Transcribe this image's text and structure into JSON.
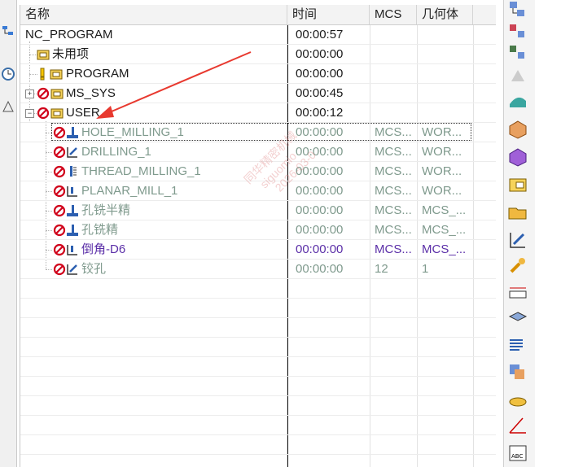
{
  "columns": {
    "name": "名称",
    "time": "时间",
    "mcs": "MCS",
    "geometry": "几何体"
  },
  "rows": [
    {
      "name": "NC_PROGRAM",
      "time": "00:00:57",
      "mcs": "",
      "geometry": ""
    },
    {
      "name": "未用项",
      "time": "00:00:00",
      "mcs": "",
      "geometry": ""
    },
    {
      "name": "PROGRAM",
      "time": "00:00:00",
      "mcs": "",
      "geometry": ""
    },
    {
      "name": "MS_SYS",
      "time": "00:00:45",
      "mcs": "",
      "geometry": ""
    },
    {
      "name": "USER",
      "time": "00:00:12",
      "mcs": "",
      "geometry": ""
    },
    {
      "name": "HOLE_MILLING_1",
      "time": "00:00:00",
      "mcs": "MCS...",
      "geometry": "WOR..."
    },
    {
      "name": "DRILLING_1",
      "time": "00:00:00",
      "mcs": "MCS...",
      "geometry": "WOR..."
    },
    {
      "name": "THREAD_MILLING_1",
      "time": "00:00:00",
      "mcs": "MCS...",
      "geometry": "WOR..."
    },
    {
      "name": "PLANAR_MILL_1",
      "time": "00:00:00",
      "mcs": "MCS...",
      "geometry": "WOR..."
    },
    {
      "name": "孔铣半精",
      "time": "00:00:00",
      "mcs": "MCS...",
      "geometry": "MCS_..."
    },
    {
      "name": "孔铣精",
      "time": "00:00:00",
      "mcs": "MCS...",
      "geometry": "MCS_..."
    },
    {
      "name": "倒角-D6",
      "time": "00:00:00",
      "mcs": "MCS...",
      "geometry": "MCS_..."
    },
    {
      "name": "铰孔",
      "time": "00:00:00",
      "mcs": "12",
      "geometry": "1"
    }
  ],
  "watermark": {
    "line1": "同华精密机械",
    "line2": "siguomio",
    "line3": "2026-03-0"
  },
  "colors": {
    "gray_text": "#7f9a8d",
    "purple_text": "#5b2fa8",
    "arrow": "#e8392f",
    "no_symbol": "#d0021b"
  },
  "right_toolbar_icons": [
    "program-view-icon",
    "machine-tool-view-icon",
    "geometry-view-icon",
    "method-view-icon",
    "create-program-icon",
    "create-tool-icon",
    "create-geometry-icon",
    "create-method-icon",
    "folder-icon",
    "open-folder-icon",
    "edit-icon",
    "wrench-icon",
    "measure-icon",
    "material-icon",
    "list-icon",
    "simulate-icon",
    "post-icon",
    "angle-icon",
    "abc-icon"
  ]
}
